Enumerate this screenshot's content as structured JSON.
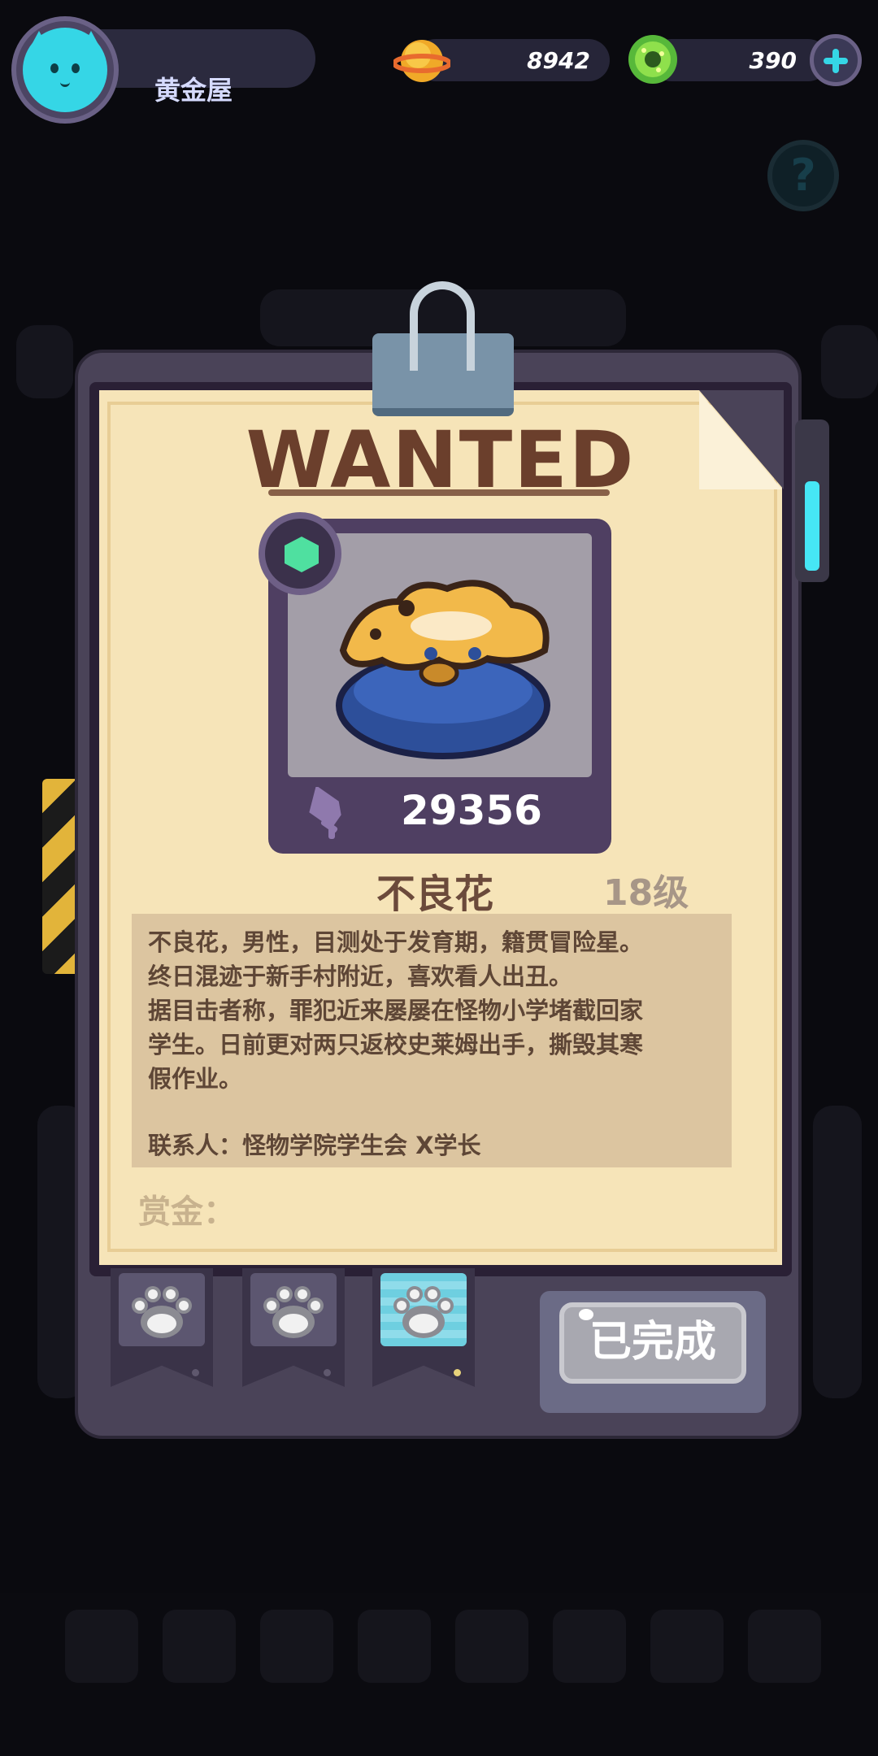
{
  "header": {
    "player_name": "黄金屋",
    "coins": "8942",
    "gems": "390"
  },
  "poster": {
    "title": "WANTED",
    "power": "29356",
    "monster_name": "不良花",
    "level": "18级",
    "description_lines": [
      "不良花，男性，目测处于发育期，籍贯冒险星。",
      "终日混迹于新手村附近，喜欢看人出丑。",
      "据目击者称，罪犯近来屡屡在怪物小学堵截回家",
      "学生。日前更对两只返校史莱姆出手，撕毁其寒",
      "假作业。"
    ],
    "contact": "联系人：怪物学院学生会 X学长",
    "reward_label": "赏金：",
    "complete_button": "已完成"
  },
  "tabs": [
    {
      "icon": "paw-icon",
      "active": false
    },
    {
      "icon": "paw-icon",
      "active": false
    },
    {
      "icon": "paw-icon",
      "active": true
    }
  ],
  "colors": {
    "accent": "#35d6e6",
    "paper": "#f6e4b8",
    "title_brown": "#6b3f2c"
  }
}
